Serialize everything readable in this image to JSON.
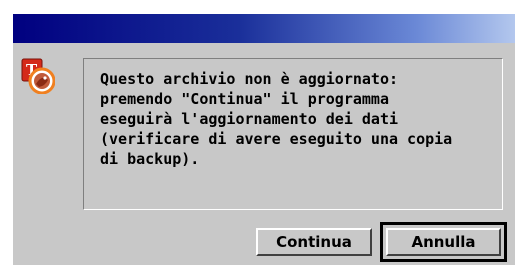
{
  "dialog": {
    "message": "Questo archivio non è aggiornato:\npremendo \"Continua\" il programma\neseguirà l'aggiornamento dei dati\n(verificare di avere eseguito una copia\ndi backup).",
    "icon": "app-logo-icon",
    "titlebar_colors": [
      "#000080",
      "#b4c8ee"
    ]
  },
  "buttons": {
    "continue_label": "Continua",
    "cancel_label": "Annulla"
  }
}
